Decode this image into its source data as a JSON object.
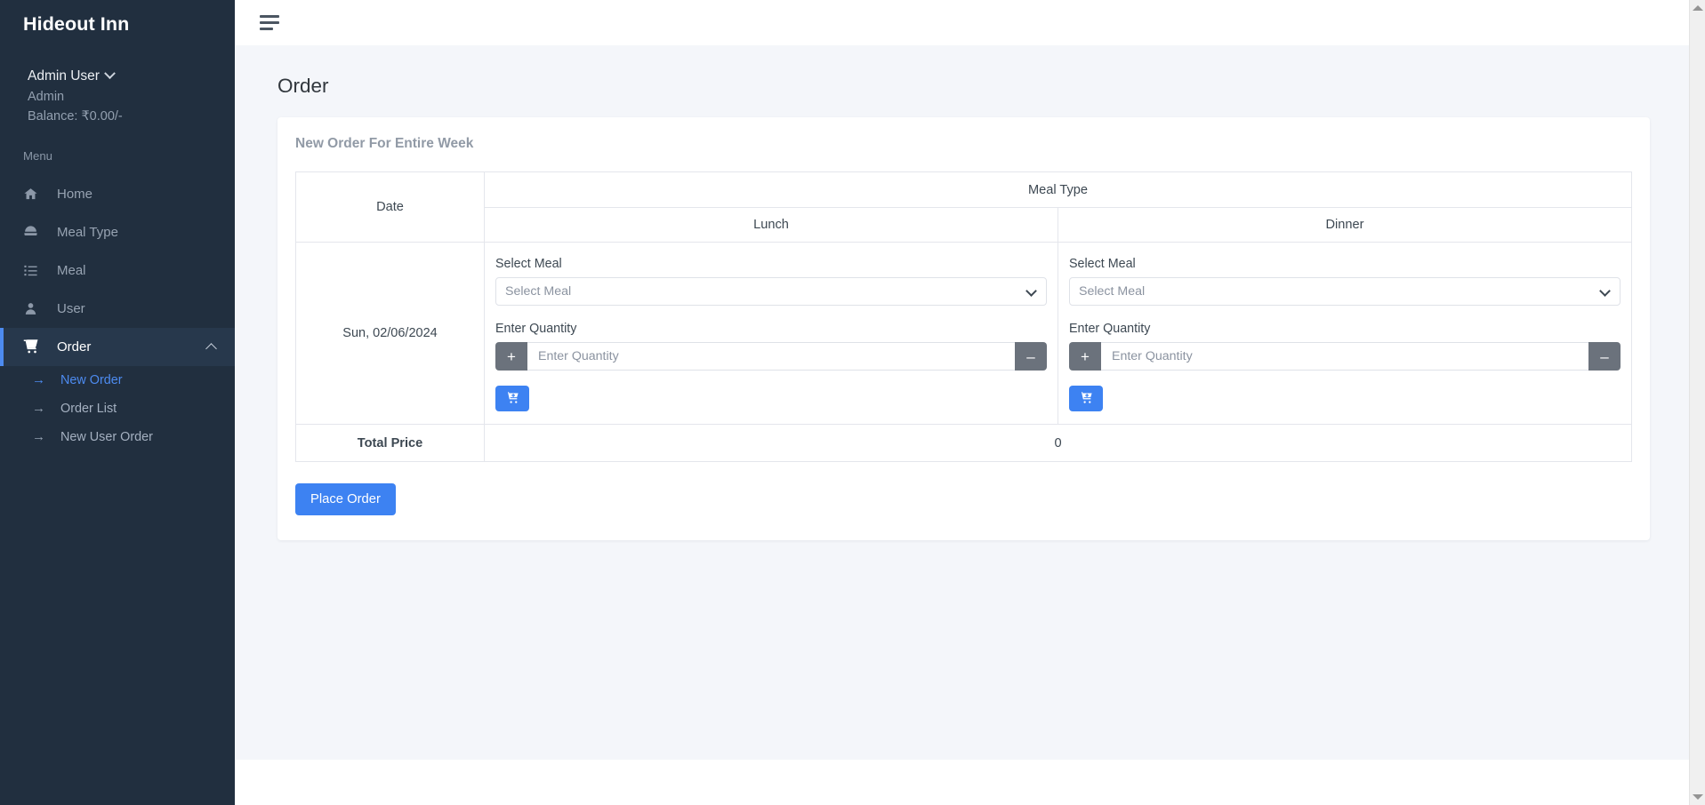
{
  "sidebar": {
    "brand": "Hideout Inn",
    "user": {
      "name": "Admin User",
      "role": "Admin",
      "balance": "Balance: ₹0.00/-"
    },
    "menu_label": "Menu",
    "items": [
      {
        "label": "Home",
        "icon": "home-icon"
      },
      {
        "label": "Meal Type",
        "icon": "bowl-icon"
      },
      {
        "label": "Meal",
        "icon": "list-icon"
      },
      {
        "label": "User",
        "icon": "user-icon"
      },
      {
        "label": "Order",
        "icon": "cart-icon"
      }
    ],
    "suborder": [
      {
        "label": "New Order"
      },
      {
        "label": "Order List"
      },
      {
        "label": "New User Order"
      }
    ]
  },
  "topbar": {
    "menu_toggle": "hamburger-menu"
  },
  "page": {
    "title": "Order",
    "card_title": "New Order For Entire Week"
  },
  "table": {
    "meal_type_header": "Meal Type",
    "date_header": "Date",
    "lunch_header": "Lunch",
    "dinner_header": "Dinner",
    "total_label": "Total Price",
    "total_value": "0",
    "row": {
      "date": "Sun, 02/06/2024",
      "lunch": {
        "select_label": "Select Meal",
        "select_value": "Select Meal",
        "qty_label": "Enter Quantity",
        "qty_value": "",
        "qty_placeholder": "Enter Quantity",
        "plus": "+",
        "minus": "–",
        "cart": "add-to-cart"
      },
      "dinner": {
        "select_label": "Select Meal",
        "select_value": "Select Meal",
        "qty_label": "Enter Quantity",
        "qty_value": "",
        "qty_placeholder": "Enter Quantity",
        "plus": "+",
        "minus": "–",
        "cart": "add-to-cart"
      }
    }
  },
  "actions": {
    "place_order": "Place Order"
  },
  "colors": {
    "sidebar_bg": "#212f3f",
    "sidebar_active_bg": "#27384c",
    "accent": "#4d8bf0",
    "primary_button": "#3d82f2",
    "content_bg": "#f4f6fa",
    "qty_button": "#6b727c"
  }
}
